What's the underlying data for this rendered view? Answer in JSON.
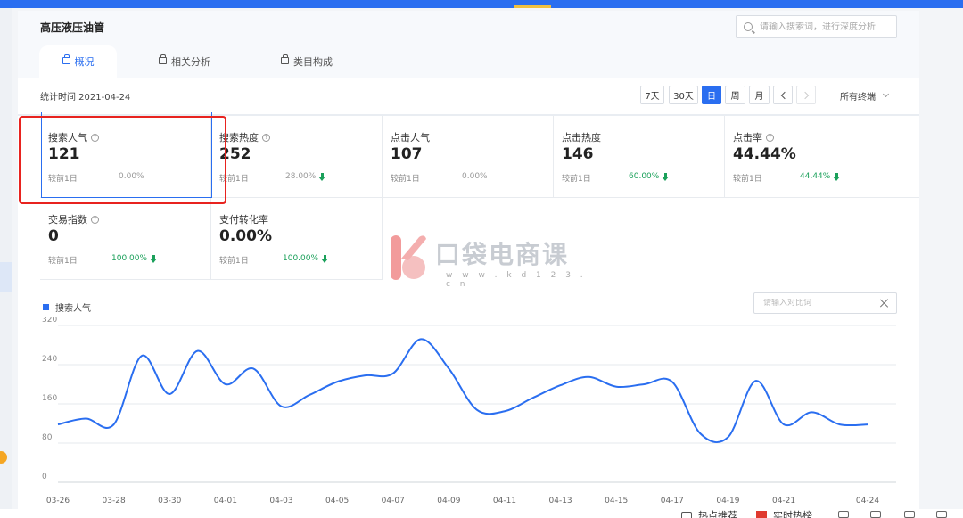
{
  "page": {
    "title": "高压液压油管",
    "search_placeholder": "请输入搜索词，进行深度分析"
  },
  "tabs": [
    {
      "label": "概况",
      "active": true
    },
    {
      "label": "相关分析",
      "active": false
    },
    {
      "label": "类目构成",
      "active": false
    }
  ],
  "stat_time": "统计时间 2021-04-24",
  "date_buttons": {
    "d7": "7天",
    "d30": "30天",
    "day": "日",
    "week": "周",
    "month": "月"
  },
  "terminal_select": "所有终端",
  "metrics": [
    {
      "label": "搜索人气",
      "value": "121",
      "compare": "较前1日",
      "change": "0.00%",
      "trend": "flat",
      "help": true
    },
    {
      "label": "搜索热度",
      "value": "252",
      "compare": "较前1日",
      "change": "28.00%",
      "trend": "down",
      "help": true
    },
    {
      "label": "点击人气",
      "value": "107",
      "compare": "较前1日",
      "change": "0.00%",
      "trend": "flat",
      "help": false
    },
    {
      "label": "点击热度",
      "value": "146",
      "compare": "较前1日",
      "change": "60.00%",
      "trend": "down",
      "help": false
    },
    {
      "label": "点击率",
      "value": "44.44%",
      "compare": "较前1日",
      "change": "44.44%",
      "trend": "down",
      "help": true
    },
    {
      "label": "交易指数",
      "value": "0",
      "compare": "较前1日",
      "change": "100.00%",
      "trend": "down",
      "help": true
    },
    {
      "label": "支付转化率",
      "value": "0.00%",
      "compare": "较前1日",
      "change": "100.00%",
      "trend": "down",
      "help": false
    }
  ],
  "watermark": {
    "text": "口袋电商课",
    "url": "w w w . k d 1 2 3 . c n"
  },
  "compare_placeholder": "请输入对比词",
  "bottom_bar": {
    "hot_recommend": "热点推荐",
    "realtime_rank": "实时热榜"
  },
  "colors": {
    "accent": "#2a6ef0",
    "down": "#1aa05a",
    "highlight": "#e8231f"
  },
  "chart_data": {
    "type": "line",
    "title": "",
    "xlabel": "",
    "ylabel": "",
    "ylim": [
      0,
      320
    ],
    "yticks": [
      0,
      80,
      160,
      240,
      320
    ],
    "grid": true,
    "legend": "top-left",
    "x_tick_labels": [
      "03-26",
      "03-28",
      "03-30",
      "04-01",
      "04-03",
      "04-05",
      "04-07",
      "04-09",
      "04-11",
      "04-13",
      "04-15",
      "04-17",
      "04-19",
      "04-21",
      "04-24"
    ],
    "series": [
      {
        "name": "搜索人气",
        "color": "#2a6ef0",
        "x": [
          "03-26",
          "03-27",
          "03-28",
          "03-29",
          "03-30",
          "03-31",
          "04-01",
          "04-02",
          "04-03",
          "04-04",
          "04-05",
          "04-06",
          "04-07",
          "04-08",
          "04-09",
          "04-10",
          "04-11",
          "04-12",
          "04-13",
          "04-14",
          "04-15",
          "04-16",
          "04-17",
          "04-18",
          "04-19",
          "04-20",
          "04-21",
          "04-22",
          "04-23",
          "04-24"
        ],
        "values": [
          118,
          130,
          118,
          258,
          180,
          268,
          200,
          232,
          155,
          178,
          205,
          218,
          222,
          292,
          232,
          148,
          145,
          172,
          198,
          215,
          195,
          200,
          205,
          100,
          92,
          207,
          118,
          143,
          118,
          118
        ]
      }
    ]
  }
}
